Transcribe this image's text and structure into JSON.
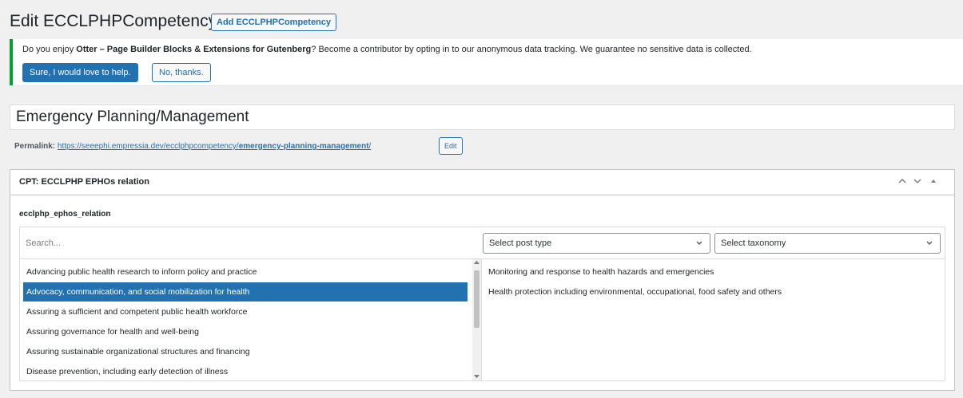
{
  "page": {
    "title": "Edit ECCLPHPCompetency",
    "add_button": "Add ECCLPHPCompetency"
  },
  "notice": {
    "text_before": "Do you enjoy ",
    "plugin_name": "Otter – Page Builder Blocks & Extensions for Gutenberg",
    "text_after": "? Become a contributor by opting in to our anonymous data tracking. We guarantee no sensitive data is collected.",
    "accept_label": "Sure, I would love to help.",
    "decline_label": "No, thanks."
  },
  "post_title": "Emergency Planning/Management",
  "permalink": {
    "label": "Permalink:",
    "base": "https://seeephi.empressia.dev/ecclphpcompetency/",
    "slug": "emergency-planning-management",
    "trailing": "/",
    "edit_label": "Edit"
  },
  "metabox": {
    "title": "CPT: ECCLPHP EPHOs relation",
    "controls": [
      "^",
      "v",
      "▲"
    ],
    "field_label": "ecclphp_ephos_relation",
    "search_placeholder": "Search...",
    "post_type_select": "Select post type",
    "taxonomy_select": "Select taxonomy",
    "choices": [
      "Advancing public health research to inform policy and practice",
      "Advocacy, communication, and social mobilization for health",
      "Assuring a sufficient and competent public health workforce",
      "Assuring governance for health and well-being",
      "Assuring sustainable organizational structures and financing",
      "Disease prevention, including early detection of illness"
    ],
    "selected_index": 1,
    "values": [
      "Monitoring and response to health hazards and emergencies",
      "Health protection including environmental, occupational, food safety and others"
    ]
  },
  "colors": {
    "accent": "#2271b1",
    "notice_border": "#00a32a",
    "background": "#f0f0f1"
  }
}
